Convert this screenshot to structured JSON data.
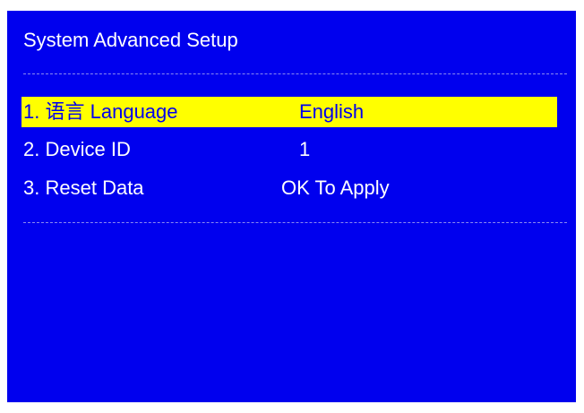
{
  "menu": {
    "title": "System Advanced Setup",
    "colors": {
      "background": "#0000ee",
      "text": "#ffffff",
      "highlight": "#ffff00",
      "highlight_text": "#0000ee"
    },
    "items": [
      {
        "number": "1.",
        "label_cjk": "语言",
        "label": "Language",
        "value": "English",
        "selected": true
      },
      {
        "number": "2.",
        "label": "Device ID",
        "value": "1",
        "selected": false
      },
      {
        "number": "3.",
        "label": "Reset Data",
        "value": "OK To Apply",
        "selected": false
      }
    ]
  }
}
